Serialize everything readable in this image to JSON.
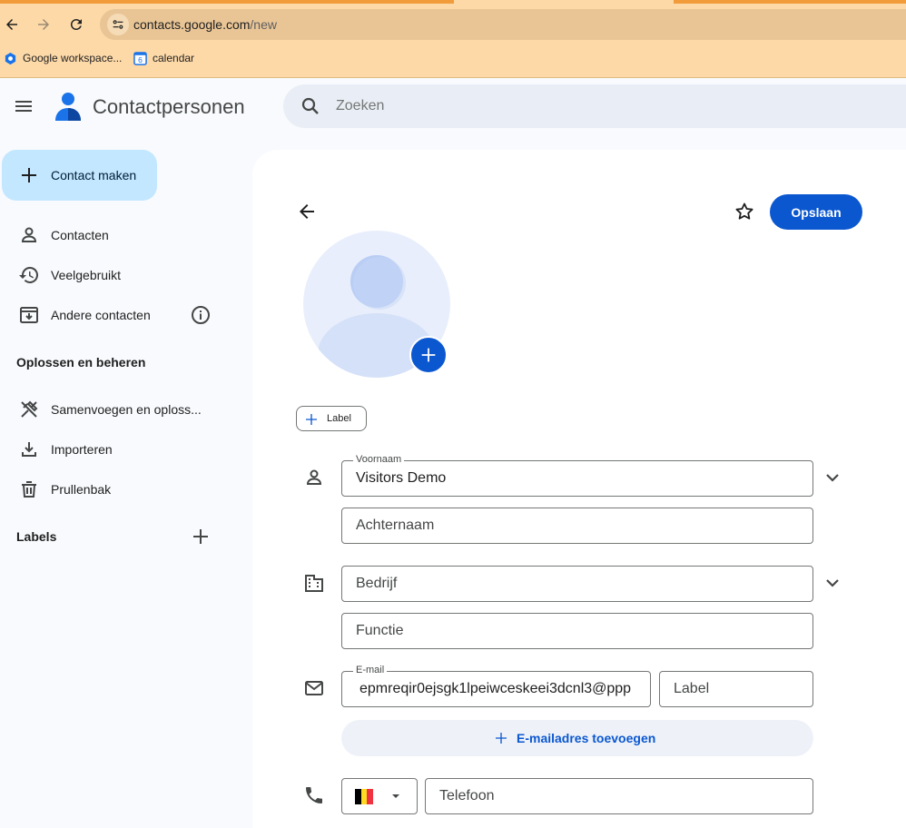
{
  "browser": {
    "url_host": "contacts.google.com",
    "url_path": "/new",
    "bookmarks": [
      {
        "label": "Google workspace...",
        "icon": "google-workspace-icon"
      },
      {
        "label": "calendar",
        "icon": "calendar-6-icon",
        "icon_text": "6"
      }
    ]
  },
  "header": {
    "app_title": "Contactpersonen",
    "search_placeholder": "Zoeken"
  },
  "sidebar": {
    "create_label": "Contact maken",
    "items": [
      {
        "label": "Contacten",
        "icon": "person-icon"
      },
      {
        "label": "Veelgebruikt",
        "icon": "history-icon"
      },
      {
        "label": "Andere contacten",
        "icon": "archive-download-icon"
      }
    ],
    "section_heading": "Oplossen en beheren",
    "manage_items": [
      {
        "label": "Samenvoegen en oploss...",
        "icon": "merge-tools-icon"
      },
      {
        "label": "Importeren",
        "icon": "download-icon"
      },
      {
        "label": "Prullenbak",
        "icon": "trash-icon"
      }
    ],
    "labels_heading": "Labels"
  },
  "form": {
    "save_label": "Opslaan",
    "label_chip": "Label",
    "first_name_label": "Voornaam",
    "first_name_value": "Visitors Demo",
    "last_name_placeholder": "Achternaam",
    "company_placeholder": "Bedrijf",
    "job_title_placeholder": "Functie",
    "email_label": "E-mail",
    "email_value": "epmreqir0ejsgk1lpeiwceskeei3dcnl3@ppp",
    "email_type_placeholder": "Label",
    "add_email_label": "E-mailadres toevoegen",
    "phone_placeholder": "Telefoon",
    "country_flag": "Belgium"
  },
  "colors": {
    "accent": "#0b57d0",
    "create_button_bg": "#c2e7ff",
    "browser_chrome": "#fdd9a8"
  }
}
